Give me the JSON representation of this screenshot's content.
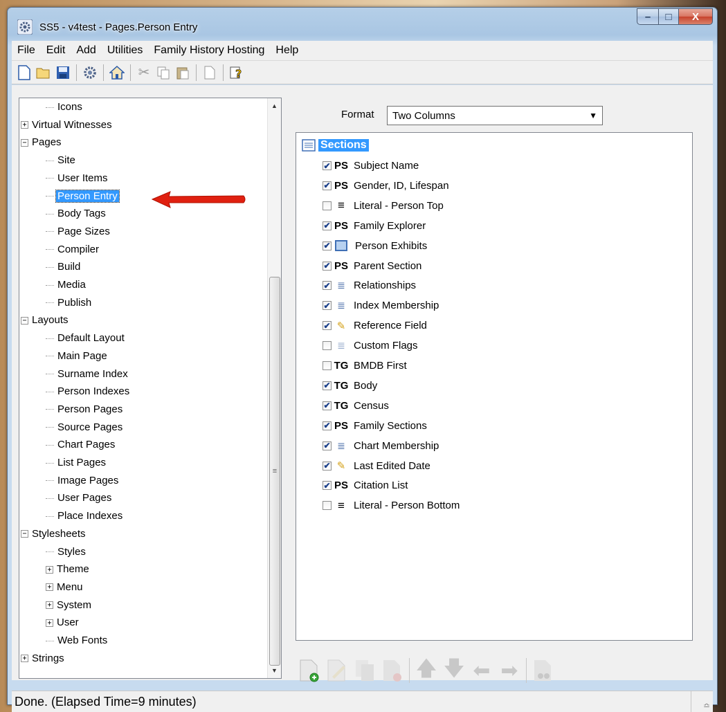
{
  "window": {
    "title": "SS5 - v4test - Pages.Person Entry",
    "minimize": "–",
    "maximize": "□",
    "close": "X"
  },
  "menu": [
    "File",
    "Edit",
    "Add",
    "Utilities",
    "Family History Hosting",
    "Help"
  ],
  "toolbar": [
    "new-icon",
    "open-icon",
    "save-icon",
    "settings-icon",
    "home-icon",
    "cut-icon",
    "copy-icon",
    "paste-icon",
    "page-icon",
    "help-icon"
  ],
  "tree": [
    {
      "label": "Icons",
      "level": 1,
      "expander": ""
    },
    {
      "label": "Virtual Witnesses",
      "level": 0,
      "expander": "+"
    },
    {
      "label": "Pages",
      "level": 0,
      "expander": "−"
    },
    {
      "label": "Site",
      "level": 1,
      "expander": ""
    },
    {
      "label": "User Items",
      "level": 1,
      "expander": ""
    },
    {
      "label": "Person Entry",
      "level": 1,
      "expander": "",
      "selected": true
    },
    {
      "label": "Body Tags",
      "level": 1,
      "expander": ""
    },
    {
      "label": "Page Sizes",
      "level": 1,
      "expander": ""
    },
    {
      "label": "Compiler",
      "level": 1,
      "expander": ""
    },
    {
      "label": "Build",
      "level": 1,
      "expander": ""
    },
    {
      "label": "Media",
      "level": 1,
      "expander": ""
    },
    {
      "label": "Publish",
      "level": 1,
      "expander": ""
    },
    {
      "label": "Layouts",
      "level": 0,
      "expander": "−"
    },
    {
      "label": "Default Layout",
      "level": 1,
      "expander": ""
    },
    {
      "label": "Main Page",
      "level": 1,
      "expander": ""
    },
    {
      "label": "Surname Index",
      "level": 1,
      "expander": ""
    },
    {
      "label": "Person Indexes",
      "level": 1,
      "expander": ""
    },
    {
      "label": "Person Pages",
      "level": 1,
      "expander": ""
    },
    {
      "label": "Source Pages",
      "level": 1,
      "expander": ""
    },
    {
      "label": "Chart Pages",
      "level": 1,
      "expander": ""
    },
    {
      "label": "List Pages",
      "level": 1,
      "expander": ""
    },
    {
      "label": "Image Pages",
      "level": 1,
      "expander": ""
    },
    {
      "label": "User Pages",
      "level": 1,
      "expander": ""
    },
    {
      "label": "Place Indexes",
      "level": 1,
      "expander": ""
    },
    {
      "label": "Stylesheets",
      "level": 0,
      "expander": "−"
    },
    {
      "label": "Styles",
      "level": 1,
      "expander": ""
    },
    {
      "label": "Theme",
      "level": 1,
      "expander": "+"
    },
    {
      "label": "Menu",
      "level": 1,
      "expander": "+"
    },
    {
      "label": "System",
      "level": 1,
      "expander": "+"
    },
    {
      "label": "User",
      "level": 1,
      "expander": "+"
    },
    {
      "label": "Web Fonts",
      "level": 1,
      "expander": ""
    },
    {
      "label": "Strings",
      "level": 0,
      "expander": "+"
    }
  ],
  "format": {
    "label": "Format",
    "value": "Two Columns"
  },
  "sections": {
    "header": "Sections",
    "items": [
      {
        "label": "Subject Name",
        "checked": true,
        "type": "PS"
      },
      {
        "label": "Gender, ID, Lifespan",
        "checked": true,
        "type": "PS"
      },
      {
        "label": "Literal - Person Top",
        "checked": false,
        "type": "literal"
      },
      {
        "label": "Family Explorer",
        "checked": true,
        "type": "PS"
      },
      {
        "label": "Person Exhibits",
        "checked": true,
        "type": "image"
      },
      {
        "label": "Parent Section",
        "checked": true,
        "type": "PS"
      },
      {
        "label": "Relationships",
        "checked": true,
        "type": "list"
      },
      {
        "label": "Index Membership",
        "checked": true,
        "type": "list"
      },
      {
        "label": "Reference Field",
        "checked": true,
        "type": "pen"
      },
      {
        "label": "Custom Flags",
        "checked": false,
        "type": "list"
      },
      {
        "label": "BMDB First",
        "checked": false,
        "type": "TG"
      },
      {
        "label": "Body",
        "checked": true,
        "type": "TG"
      },
      {
        "label": "Census",
        "checked": true,
        "type": "TG"
      },
      {
        "label": "Family Sections",
        "checked": true,
        "type": "PS"
      },
      {
        "label": "Chart Membership",
        "checked": true,
        "type": "list"
      },
      {
        "label": "Last Edited Date",
        "checked": true,
        "type": "pen"
      },
      {
        "label": "Citation List",
        "checked": true,
        "type": "PS"
      },
      {
        "label": "Literal - Person Bottom",
        "checked": false,
        "type": "literal"
      }
    ]
  },
  "bottom_tools": [
    "add-section-icon",
    "edit-section-icon",
    "copy-section-icon",
    "delete-section-icon",
    "move-up-icon",
    "move-down-icon",
    "move-left-icon",
    "move-right-icon",
    "find-icon"
  ],
  "status": "Done. (Elapsed Time=9 minutes)"
}
